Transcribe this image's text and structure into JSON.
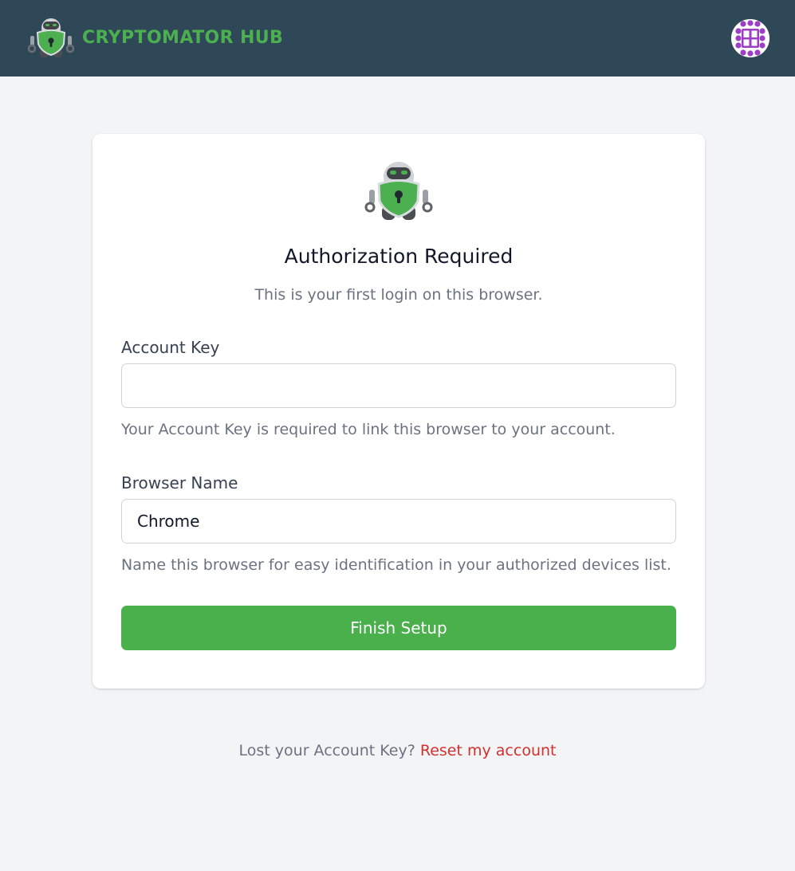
{
  "header": {
    "brand_name": "CRYPTOMATOR HUB",
    "logo_icon": "cryptomator-robot-icon",
    "avatar_icon": "identicon-avatar",
    "colors": {
      "bar": "#2f4858",
      "brand_text": "#4caf50",
      "avatar_pattern": "#9c3fc4"
    }
  },
  "card": {
    "logo_icon": "cryptomator-robot-icon",
    "title": "Authorization Required",
    "subtitle": "This is your first login on this browser.",
    "account_key": {
      "label": "Account Key",
      "value": "",
      "placeholder": "",
      "help": "Your Account Key is required to link this browser to your account."
    },
    "browser_name": {
      "label": "Browser Name",
      "value": "Chrome",
      "placeholder": "",
      "help": "Name this browser for easy identification in your authorized devices list."
    },
    "submit_label": "Finish Setup",
    "accent_color": "#49b04c"
  },
  "footer": {
    "prompt": "Lost your Account Key?",
    "reset_label": "Reset my account",
    "link_color": "#d32f2f"
  }
}
